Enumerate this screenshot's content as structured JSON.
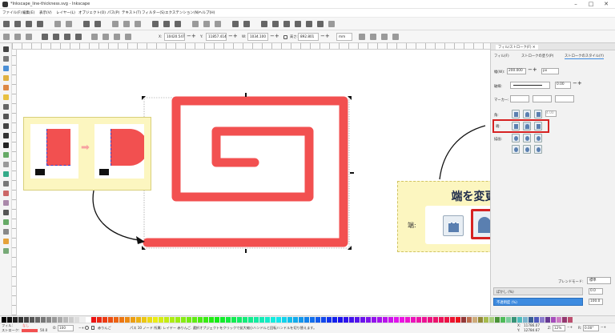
{
  "window": {
    "title": "*Inkscape_line-thickness.svg - Inkscape",
    "controls": [
      "–",
      "□",
      "✕"
    ]
  },
  "menu": [
    "ファイル(F)",
    "編集(E)",
    "表示(V)",
    "レイヤー(L)",
    "オブジェクト(O)",
    "パス(P)",
    "テキスト(T)",
    "フィルター(S)",
    "エクステンション(N)",
    "ヘルプ(H)"
  ],
  "toolbar2": {
    "x_label": "X:",
    "x_value": "10420.547",
    "y_label": "Y:",
    "y_value": "11857.414",
    "w_label": "W:",
    "w_value": "1034.100",
    "h_label": "高さ:",
    "h_value": "892.801",
    "unit": "mm"
  },
  "panel": {
    "dock_title": "フィル/ストローク(F) ✕",
    "tabs": [
      "フィル(F)",
      "ストロークの塗り(P)",
      "ストロークのスタイル(Y)"
    ],
    "width_label": "幅(W):",
    "width_value": "200.000",
    "width_unit": "px",
    "dash_label": "破線:",
    "dash_offset": "0.00",
    "markers_label": "マーカー:",
    "join_label": "角:",
    "miter_value": "4.00",
    "cap_label": "端:",
    "order_label": "描画:",
    "blend_label": "ブレンドモード:",
    "blend_value": "標準",
    "blur_label": "ぼかし (%)",
    "blur_value": "0.0",
    "opacity_label": "不透明度 (%)",
    "opacity_value": "100.0"
  },
  "annotation": {
    "title": "端を変更",
    "cap_label": "端:"
  },
  "statusbar": {
    "fill_label": "フィル:",
    "stroke_label": "ストローク:",
    "fill_none": "なし",
    "stroke_width": "50.0",
    "opacity_label": "O:",
    "opacity_value": "100",
    "layer": "赤りんご",
    "message": "パス 10 ノード 所属: レイヤー 赤りんご. 選択オブジェクトをクリックで拡大縮小ハンドルと回転ハンドルを切り替えます。",
    "x_label": "X:",
    "x_value": "11786.07",
    "y_label": "Y:",
    "y_value": "12784.67",
    "z_label": "Z:",
    "zoom": "12%",
    "r_label": "R:",
    "rotation": "0.00°"
  },
  "colors": {
    "accent_red": "#f25050",
    "highlight_red": "#d62222",
    "annotation_bg": "#fcf6c0",
    "annotation_border": "#d8cf7a",
    "opacity_bar": "#3d8be0",
    "cap_blue": "#5a7fb0"
  }
}
